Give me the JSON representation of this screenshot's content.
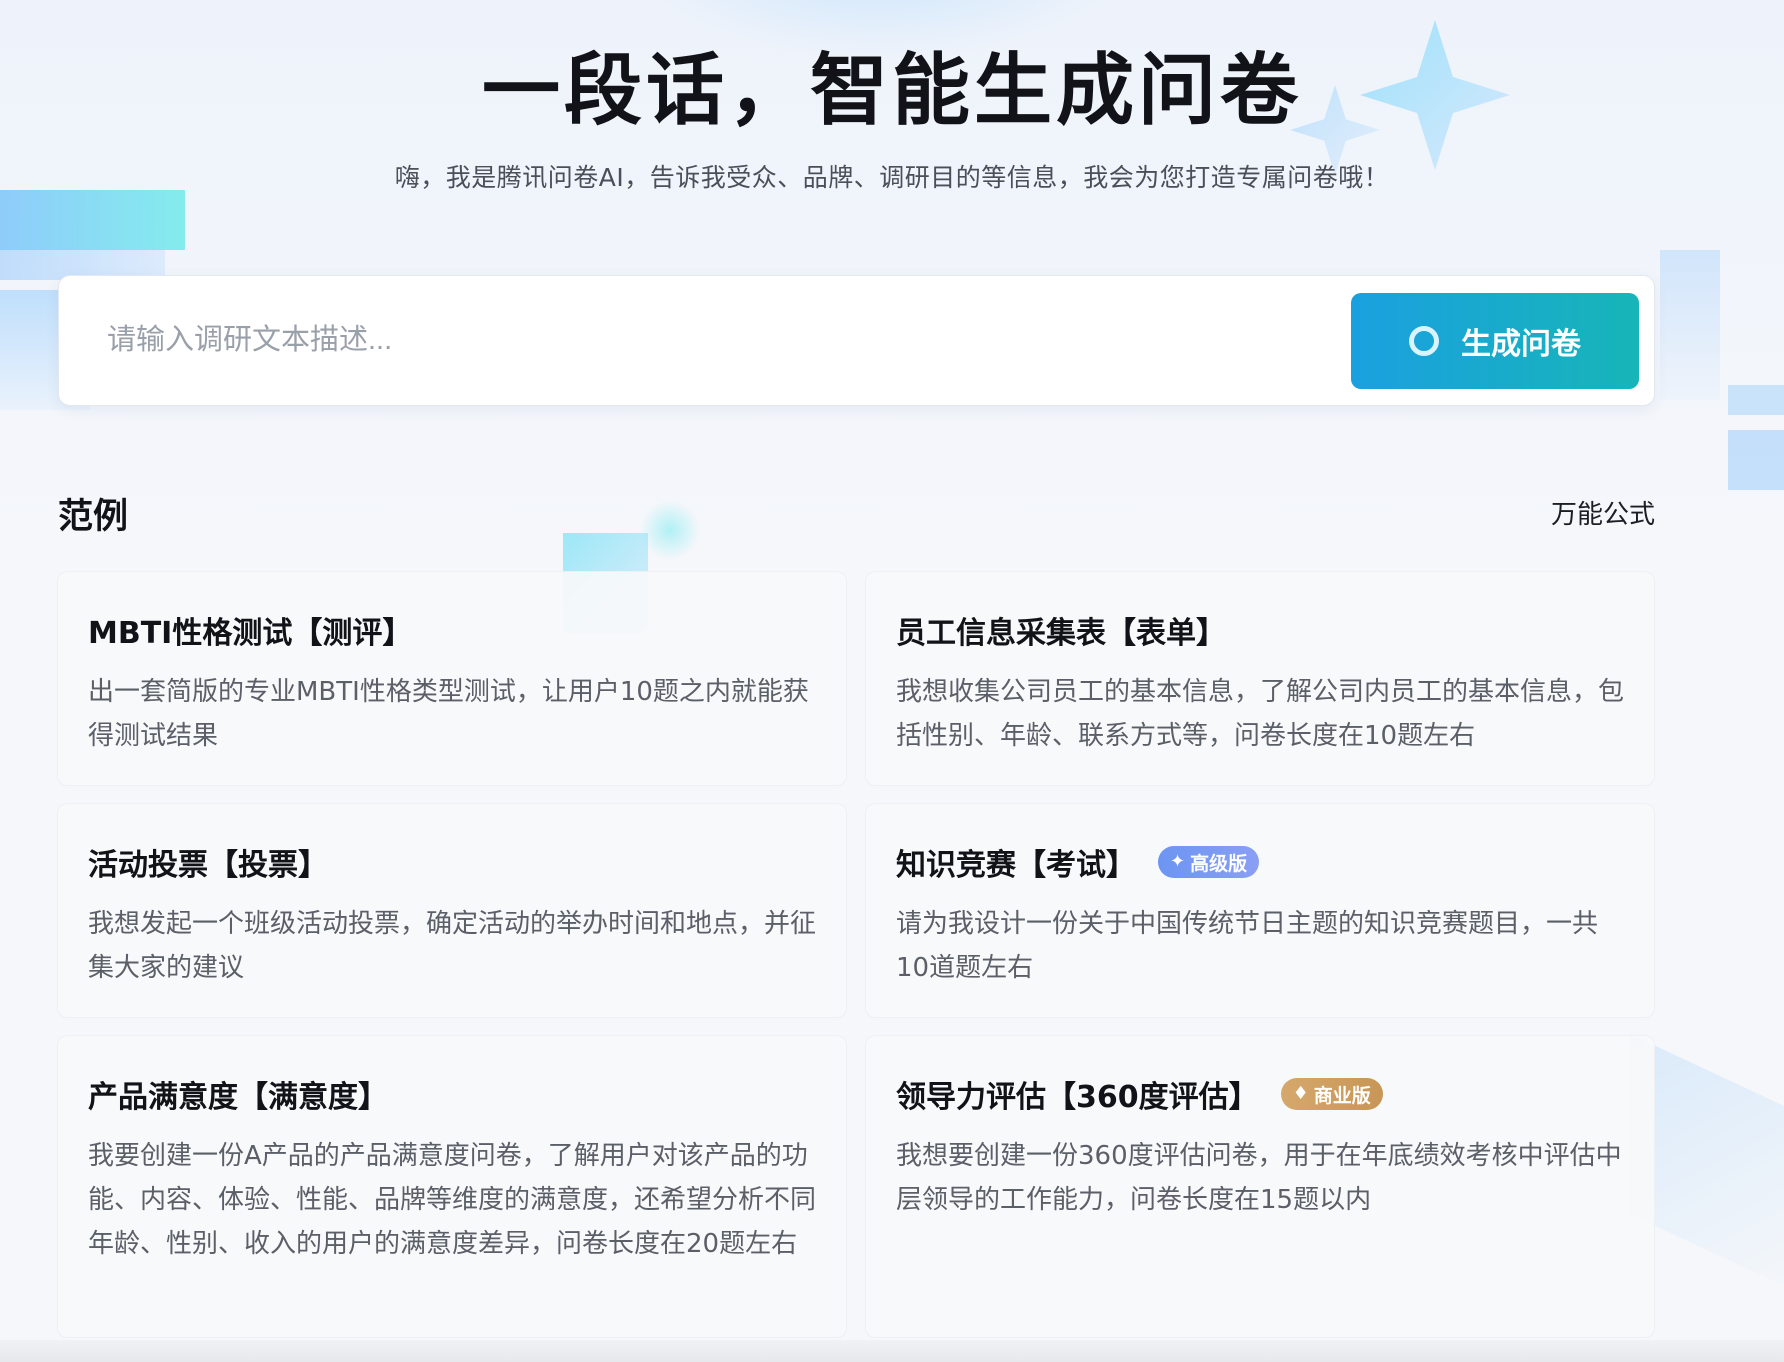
{
  "header": {
    "title": "一段话，智能生成问卷",
    "subtitle": "嗨，我是腾讯问卷AI，告诉我受众、品牌、调研目的等信息，我会为您打造专属问卷哦！"
  },
  "search": {
    "placeholder": "请输入调研文本描述...",
    "value": "",
    "button_label": "生成问卷",
    "button_icon": "ring-icon"
  },
  "examples": {
    "section_title": "范例",
    "formula_link": "万能公式",
    "cards": [
      {
        "title": "MBTI性格测试【测评】",
        "description": "出一套简版的专业MBTI性格类型测试，让用户10题之内就能获得测试结果"
      },
      {
        "title": "员工信息采集表【表单】",
        "description": "我想收集公司员工的基本信息，了解公司内员工的基本信息，包括性别、年龄、联系方式等，问卷长度在10题左右"
      },
      {
        "title": "活动投票【投票】",
        "description": "我想发起一个班级活动投票，确定活动的举办时间和地点，并征集大家的建议"
      },
      {
        "title": "知识竞赛【考试】",
        "badge": "高级版",
        "badge_icon": "sparkle-icon",
        "badge_color": "#7b9af3",
        "description": "请为我设计一份关于中国传统节日主题的知识竞赛题目，一共10道题左右"
      },
      {
        "title": "产品满意度【满意度】",
        "description": "我要创建一份A产品的产品满意度问卷，了解用户对该产品的功能、内容、体验、性能、品牌等维度的满意度，还希望分析不同年龄、性别、收入的用户的满意度差异，问卷长度在20题左右"
      },
      {
        "title": "领导力评估【360度评估】",
        "badge": "商业版",
        "badge_icon": "diamond-icon",
        "badge_color": "#cf9f62",
        "description": "我想要创建一份360度评估问卷，用于在年底绩效考核中评估中层领导的工作能力，问卷长度在15题以内"
      }
    ]
  },
  "colors": {
    "button_gradient_start": "#1aa0e0",
    "button_gradient_end": "#17b5b8",
    "card_background": "#f7f8fa",
    "text_primary": "#111318",
    "text_secondary": "#5a5f68"
  }
}
